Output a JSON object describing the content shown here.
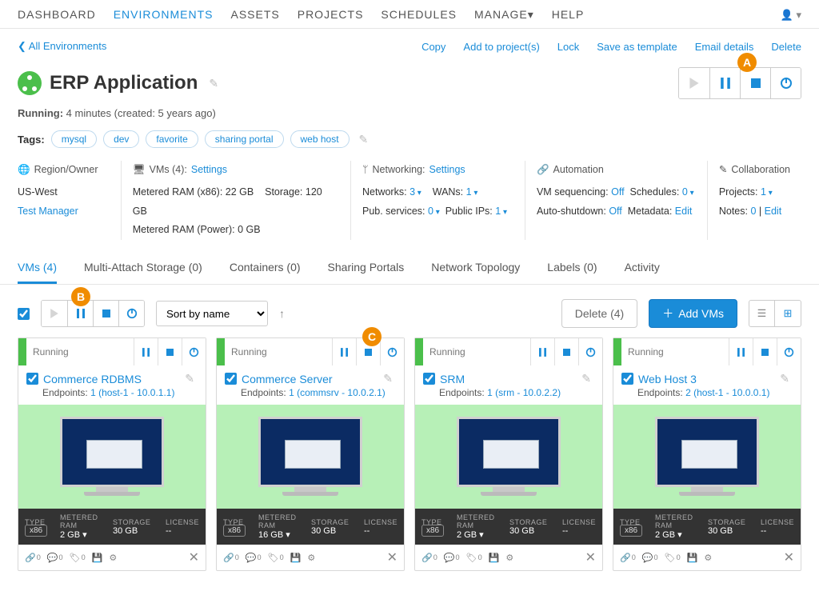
{
  "nav": [
    "DASHBOARD",
    "ENVIRONMENTS",
    "ASSETS",
    "PROJECTS",
    "SCHEDULES",
    "MANAGE▾",
    "HELP"
  ],
  "nav_active": 1,
  "back_link": "All Environments",
  "actions": {
    "copy": "Copy",
    "add_proj": "Add to project(s)",
    "lock": "Lock",
    "save_tmpl": "Save as template",
    "email": "Email details",
    "delete": "Delete"
  },
  "title": "ERP Application",
  "status_line": {
    "label": "Running:",
    "value": "4 minutes (created: 5 years ago)"
  },
  "tags_label": "Tags:",
  "tags": [
    "mysql",
    "dev",
    "favorite",
    "sharing portal",
    "web host"
  ],
  "info": {
    "region": {
      "hd": "Region/Owner",
      "region": "US-West",
      "owner": "Test Manager"
    },
    "vms": {
      "hd": "VMs (4):",
      "settings": "Settings",
      "ram_x86_lbl": "Metered RAM (x86):",
      "ram_x86": "22 GB",
      "storage_lbl": "Storage:",
      "storage": "120 GB",
      "ram_p_lbl": "Metered RAM (Power):",
      "ram_p": "0 GB"
    },
    "net": {
      "hd": "Networking:",
      "settings": "Settings",
      "networks_lbl": "Networks:",
      "networks": "3",
      "wans_lbl": "WANs:",
      "wans": "1",
      "pub_lbl": "Pub. services:",
      "pub": "0",
      "pip_lbl": "Public IPs:",
      "pip": "1"
    },
    "auto": {
      "hd": "Automation",
      "seq_lbl": "VM sequencing:",
      "seq": "Off",
      "sched_lbl": "Schedules:",
      "sched": "0",
      "shut_lbl": "Auto-shutdown:",
      "shut": "Off",
      "meta_lbl": "Metadata:",
      "meta": "Edit"
    },
    "collab": {
      "hd": "Collaboration",
      "proj_lbl": "Projects:",
      "proj": "1",
      "notes_lbl": "Notes:",
      "notes": "0",
      "edit": "Edit"
    }
  },
  "tabs": [
    "VMs (4)",
    "Multi-Attach Storage (0)",
    "Containers (0)",
    "Sharing Portals",
    "Network Topology",
    "Labels (0)",
    "Activity"
  ],
  "vm_toolbar": {
    "sort": "Sort by name",
    "delete": "Delete (4)",
    "add": "Add VMs"
  },
  "callouts": {
    "a": "A",
    "b": "B",
    "c": "C"
  },
  "spec_labels": {
    "type": "TYPE",
    "ram": "METERED RAM",
    "storage": "STORAGE",
    "license": "LICENSE"
  },
  "status_running": "Running",
  "endpoints_lbl": "Endpoints:",
  "vms": [
    {
      "name": "Commerce RDBMS",
      "endpoint": "1 (host-1 - 10.0.1.1)",
      "type": "x86",
      "ram": "2 GB",
      "storage": "30 GB",
      "license": "--"
    },
    {
      "name": "Commerce Server",
      "endpoint": "1 (commsrv - 10.0.2.1)",
      "type": "x86",
      "ram": "16 GB",
      "storage": "30 GB",
      "license": "--"
    },
    {
      "name": "SRM",
      "endpoint": "1 (srm - 10.0.2.2)",
      "type": "x86",
      "ram": "2 GB",
      "storage": "30 GB",
      "license": "--"
    },
    {
      "name": "Web Host 3",
      "endpoint": "2 (host-1 - 10.0.0.1)",
      "type": "x86",
      "ram": "2 GB",
      "storage": "30 GB",
      "license": "--"
    }
  ]
}
